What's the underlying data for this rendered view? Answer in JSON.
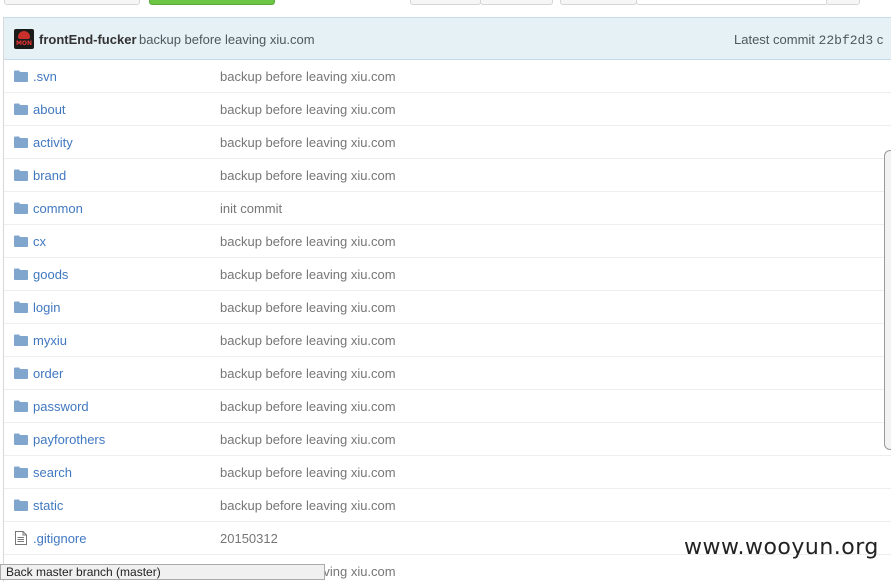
{
  "commit_bar": {
    "avatar_label": "MON",
    "author": "frontEnd-fucker",
    "message": "backup before leaving xiu.com",
    "latest_label": "Latest commit",
    "sha": "22bf2d3",
    "trailing": "c"
  },
  "rows": [
    {
      "type": "folder",
      "name": ".svn",
      "message": "backup before leaving xiu.com"
    },
    {
      "type": "folder",
      "name": "about",
      "message": "backup before leaving xiu.com"
    },
    {
      "type": "folder",
      "name": "activity",
      "message": "backup before leaving xiu.com"
    },
    {
      "type": "folder",
      "name": "brand",
      "message": "backup before leaving xiu.com"
    },
    {
      "type": "folder",
      "name": "common",
      "message": "init commit"
    },
    {
      "type": "folder",
      "name": "cx",
      "message": "backup before leaving xiu.com"
    },
    {
      "type": "folder",
      "name": "goods",
      "message": "backup before leaving xiu.com"
    },
    {
      "type": "folder",
      "name": "login",
      "message": "backup before leaving xiu.com"
    },
    {
      "type": "folder",
      "name": "myxiu",
      "message": "backup before leaving xiu.com"
    },
    {
      "type": "folder",
      "name": "order",
      "message": "backup before leaving xiu.com"
    },
    {
      "type": "folder",
      "name": "password",
      "message": "backup before leaving xiu.com"
    },
    {
      "type": "folder",
      "name": "payforothers",
      "message": "backup before leaving xiu.com"
    },
    {
      "type": "folder",
      "name": "search",
      "message": "backup before leaving xiu.com"
    },
    {
      "type": "folder",
      "name": "static",
      "message": "backup before leaving xiu.com"
    },
    {
      "type": "file",
      "name": ".gitignore",
      "message": "20150312"
    },
    {
      "type": "file",
      "name": "",
      "message": "backup before leaving xiu.com"
    }
  ],
  "watermark": "www.wooyun.org",
  "status_tip": "Back master branch (master)",
  "colors": {
    "link": "#4078c0",
    "commit_bar_bg": "#e6f1f6",
    "folder_icon": "#80a6cd",
    "green_button": "#6cc644"
  },
  "icons": {
    "folder": "folder-icon",
    "file": "file-icon"
  }
}
